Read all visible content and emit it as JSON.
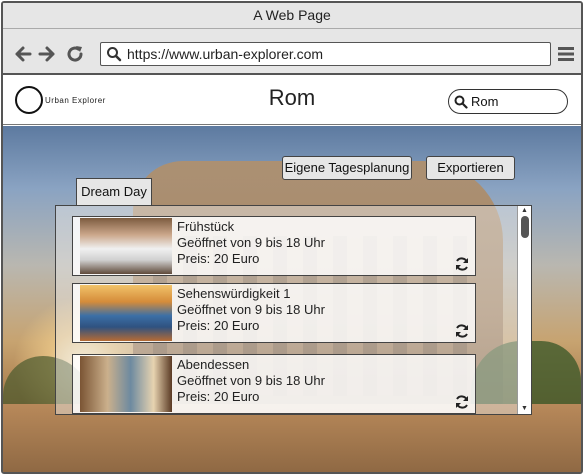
{
  "browser": {
    "title": "A Web Page",
    "url": "https://www.urban-explorer.com"
  },
  "site": {
    "logo_text": "Urban Explorer",
    "city": "Rom",
    "search_value": "Rom"
  },
  "actions": {
    "plan_label": "Eigene Tagesplanung",
    "export_label": "Exportieren"
  },
  "tab": {
    "label": "Dream Day"
  },
  "items": [
    {
      "title": "Frühstück",
      "hours": "Geöffnet von 9 bis 18 Uhr",
      "price": "Preis: 20 Euro"
    },
    {
      "title": "Sehenswürdigkeit 1",
      "hours": "Geöffnet von 9 bis 18 Uhr",
      "price": "Preis: 20 Euro"
    },
    {
      "title": "Abendessen",
      "hours": "Geöffnet von 9 bis 18 Uhr",
      "price": "Preis: 20 Euro"
    }
  ],
  "icons": {
    "back": "arrow-left-icon",
    "forward": "arrow-right-icon",
    "reload": "reload-icon",
    "search": "search-icon",
    "menu": "hamburger-icon",
    "refresh": "refresh-icon"
  }
}
